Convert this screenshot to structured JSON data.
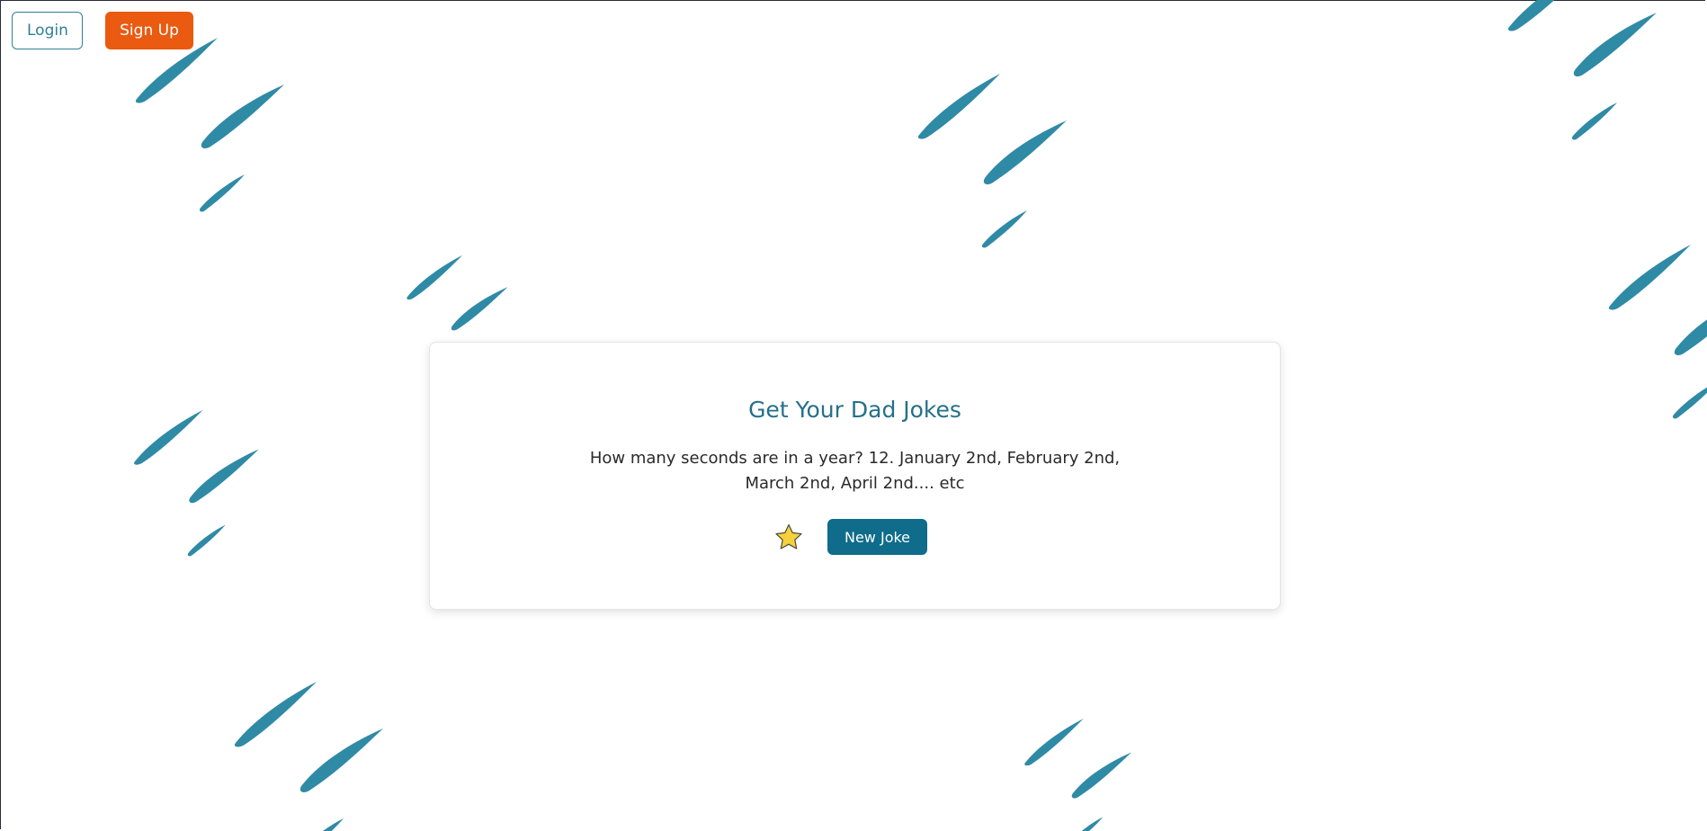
{
  "nav": {
    "login_label": "Login",
    "signup_label": "Sign Up"
  },
  "card": {
    "title": "Get Your Dad Jokes",
    "joke": "How many seconds are in a year? 12. January 2nd, February 2nd, March 2nd, April 2nd.... etc",
    "favorite_icon": "star-icon",
    "new_joke_label": "New Joke"
  },
  "colors": {
    "accent": "#0f6c8a",
    "signup": "#ea5a11",
    "decor": "#2f8aa5",
    "star": "#f6d13c"
  },
  "background_icon": "brush-stroke-icon"
}
